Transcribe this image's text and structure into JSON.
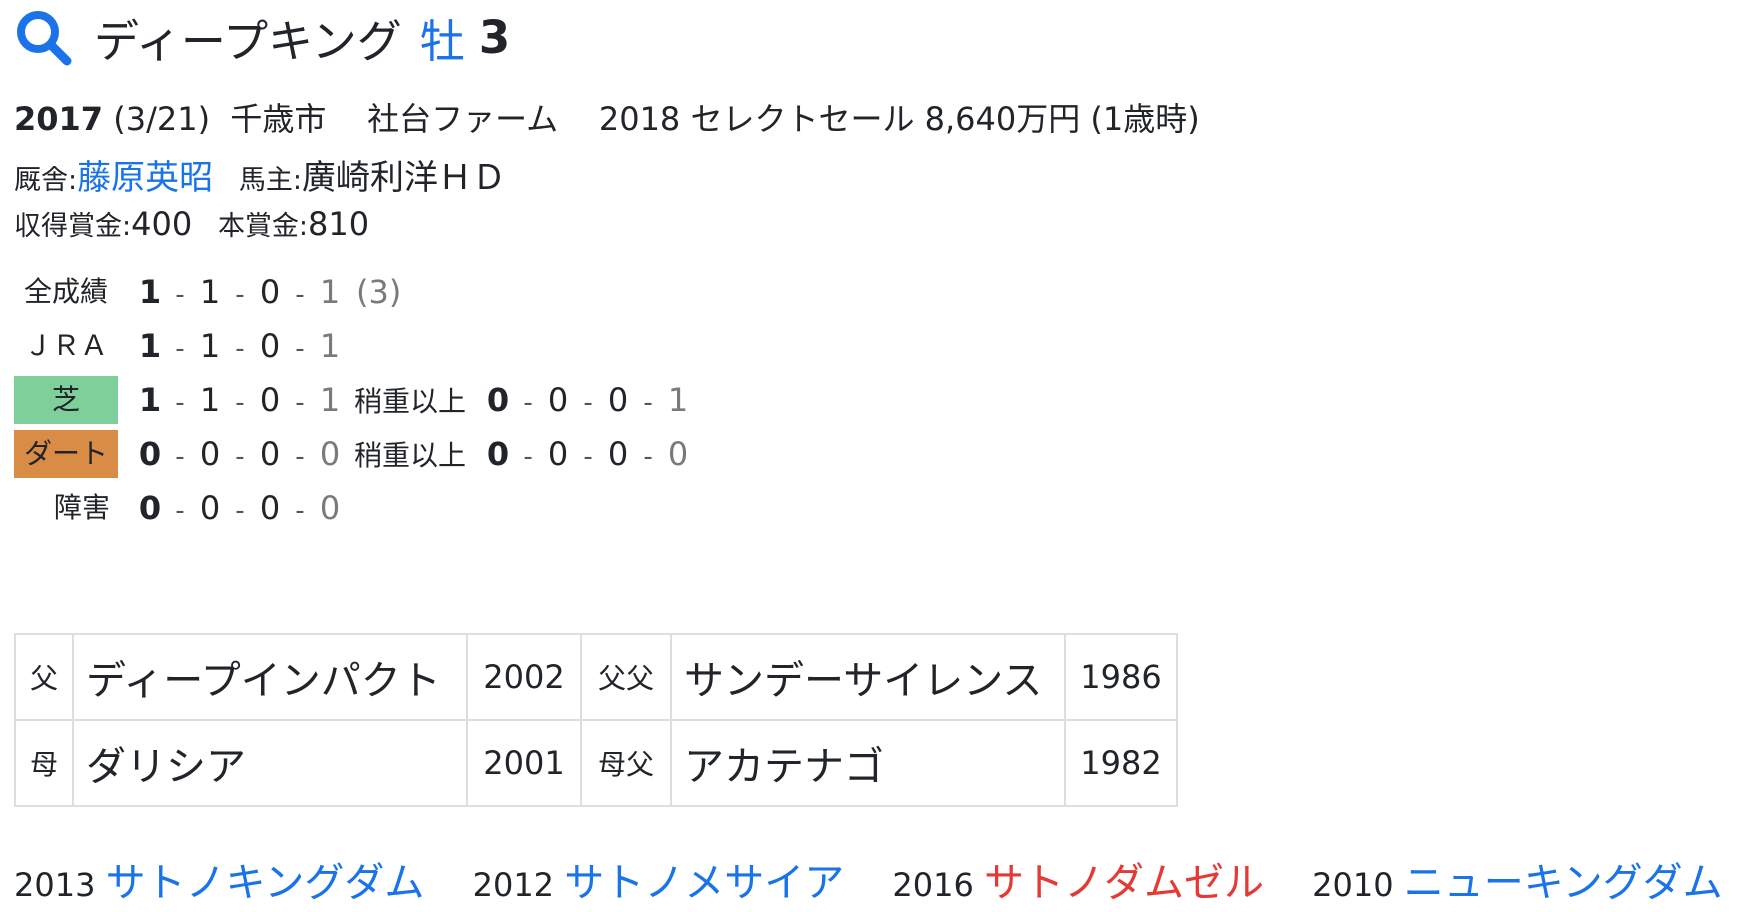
{
  "header": {
    "name": "ディープキング",
    "sex": "牡",
    "age": "3"
  },
  "profile": {
    "birth_year": "2017",
    "birth_date": "(3/21)",
    "birthplace": "千歳市",
    "breeder": "社台ファーム",
    "sale": "2018 セレクトセール 8,640万円 (1歳時)",
    "trainer_label": "厩舎:",
    "trainer": "藤原英昭",
    "owner_label": "馬主:",
    "owner": "廣崎利洋ＨＤ",
    "earned_label": "収得賞金:",
    "earned": "400",
    "prize_label": "本賞金:",
    "prize": "810"
  },
  "records": [
    {
      "label": "全成績",
      "vals": [
        "1",
        "1",
        "0",
        "1"
      ],
      "extra": "(3)"
    },
    {
      "label": "ＪＲＡ",
      "vals": [
        "1",
        "1",
        "0",
        "1"
      ]
    },
    {
      "label": "芝",
      "vals": [
        "1",
        "1",
        "0",
        "1"
      ],
      "sub_label": "稍重以上",
      "sub_vals": [
        "0",
        "0",
        "0",
        "1"
      ]
    },
    {
      "label": "ダート",
      "vals": [
        "0",
        "0",
        "0",
        "0"
      ],
      "sub_label": "稍重以上",
      "sub_vals": [
        "0",
        "0",
        "0",
        "0"
      ]
    },
    {
      "label": "障害",
      "vals": [
        "0",
        "0",
        "0",
        "0"
      ]
    }
  ],
  "pedigree": {
    "sire_label": "父",
    "sire": "ディープインパクト",
    "sire_year": "2002",
    "sire_sire_label": "父父",
    "sire_sire": "サンデーサイレンス",
    "sire_sire_year": "1986",
    "dam_label": "母",
    "dam": "ダリシア",
    "dam_year": "2001",
    "dam_sire_label": "母父",
    "dam_sire": "アカテナゴ",
    "dam_sire_year": "1982"
  },
  "siblings": [
    {
      "year": "2013",
      "name": "サトノキングダム",
      "color": "#1a73e8"
    },
    {
      "year": "2012",
      "name": "サトノメサイア",
      "color": "#1a73e8"
    },
    {
      "year": "2016",
      "name": "サトノダムゼル",
      "color": "#e53935"
    },
    {
      "year": "2010",
      "name": "ニューキングダム",
      "color": "#1a73e8"
    }
  ],
  "colors": {
    "link": "#1a73e8",
    "female": "#e53935",
    "turf": "#7ecf9a",
    "dirt": "#d98c45"
  }
}
